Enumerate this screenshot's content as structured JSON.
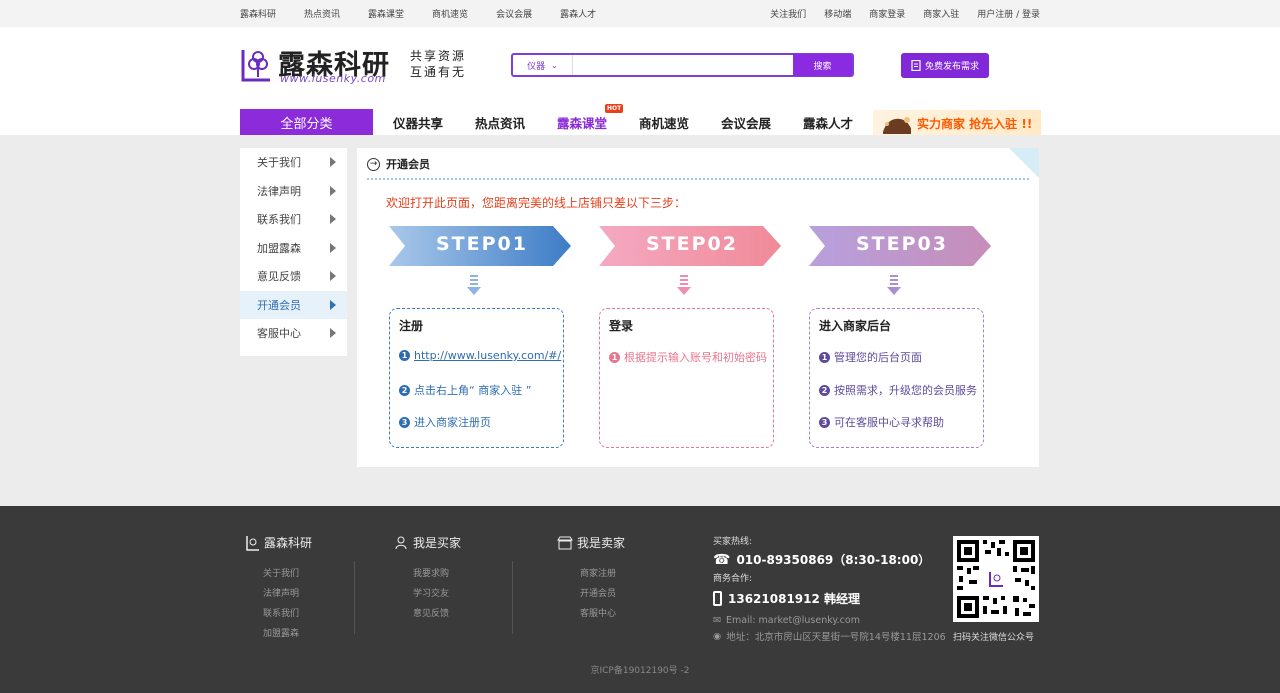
{
  "topbar": {
    "left": [
      "露森科研",
      "热点资讯",
      "露森课堂",
      "商机速览",
      "会议会展",
      "露森人才"
    ],
    "right": [
      "关注我们",
      "移动端",
      "商家登录",
      "商家入驻",
      "用户注册 / 登录"
    ]
  },
  "logo": {
    "name": "露森科研",
    "url": "www.lusenky.com"
  },
  "slogan": {
    "line1": "共享资源",
    "line2": "互通有无"
  },
  "search": {
    "category": "仪器",
    "placeholder": "",
    "button": "搜索"
  },
  "publish_button": "免费发布需求",
  "nav": {
    "all_categories": "全部分类",
    "items": [
      "仪器共享",
      "热点资讯",
      "露森课堂",
      "商机速览",
      "会议会展",
      "露森人才"
    ],
    "active": "露森课堂",
    "hot_badge": "HOT",
    "banner": "实力商家  抢先入驻 !!"
  },
  "sidebar": {
    "items": [
      "关于我们",
      "法律声明",
      "联系我们",
      "加盟露森",
      "意见反馈",
      "开通会员",
      "客服中心"
    ],
    "active": "开通会员"
  },
  "content": {
    "title": "开通会员",
    "welcome": "欢迎打开此页面，您距离完美的线上店铺只差以下三步：",
    "steps": [
      {
        "label": "STEP01",
        "heading": "注册",
        "color": "#3a7cc4",
        "items": [
          "http://www.lusenky.com/#/",
          "点击右上角“ 商家入驻 ”",
          "进入商家注册页"
        ]
      },
      {
        "label": "STEP02",
        "heading": "登录",
        "color": "#e8768e",
        "items": [
          "根据提示输入账号和初始密码"
        ]
      },
      {
        "label": "STEP03",
        "heading": "进入商家后台",
        "color": "#8f6bb4",
        "items": [
          "管理您的后台页面",
          "按照需求，升级您的会员服务",
          "可在客服中心寻求帮助"
        ]
      }
    ]
  },
  "footer": {
    "col1": {
      "title": "露森科研",
      "links": [
        "关于我们",
        "法律声明",
        "联系我们",
        "加盟露森"
      ]
    },
    "col2": {
      "title": "我是买家",
      "links": [
        "我要求购",
        "学习交友",
        "意见反馈"
      ]
    },
    "col3": {
      "title": "我是卖家",
      "links": [
        "商家注册",
        "开通会员",
        "客服中心"
      ]
    },
    "contact": {
      "buyer_label": "买家热线:",
      "buyer_phone": "010-89350869（8:30-18:00）",
      "biz_label": "商务合作:",
      "biz_phone": "13621081912  韩经理",
      "email": "Email: market@lusenky.com",
      "address": "地址：北京市房山区天星街一号院14号楼11层1206"
    },
    "qr_caption": "扫码关注微信公众号",
    "icp": "京ICP备19012190号 -2"
  }
}
